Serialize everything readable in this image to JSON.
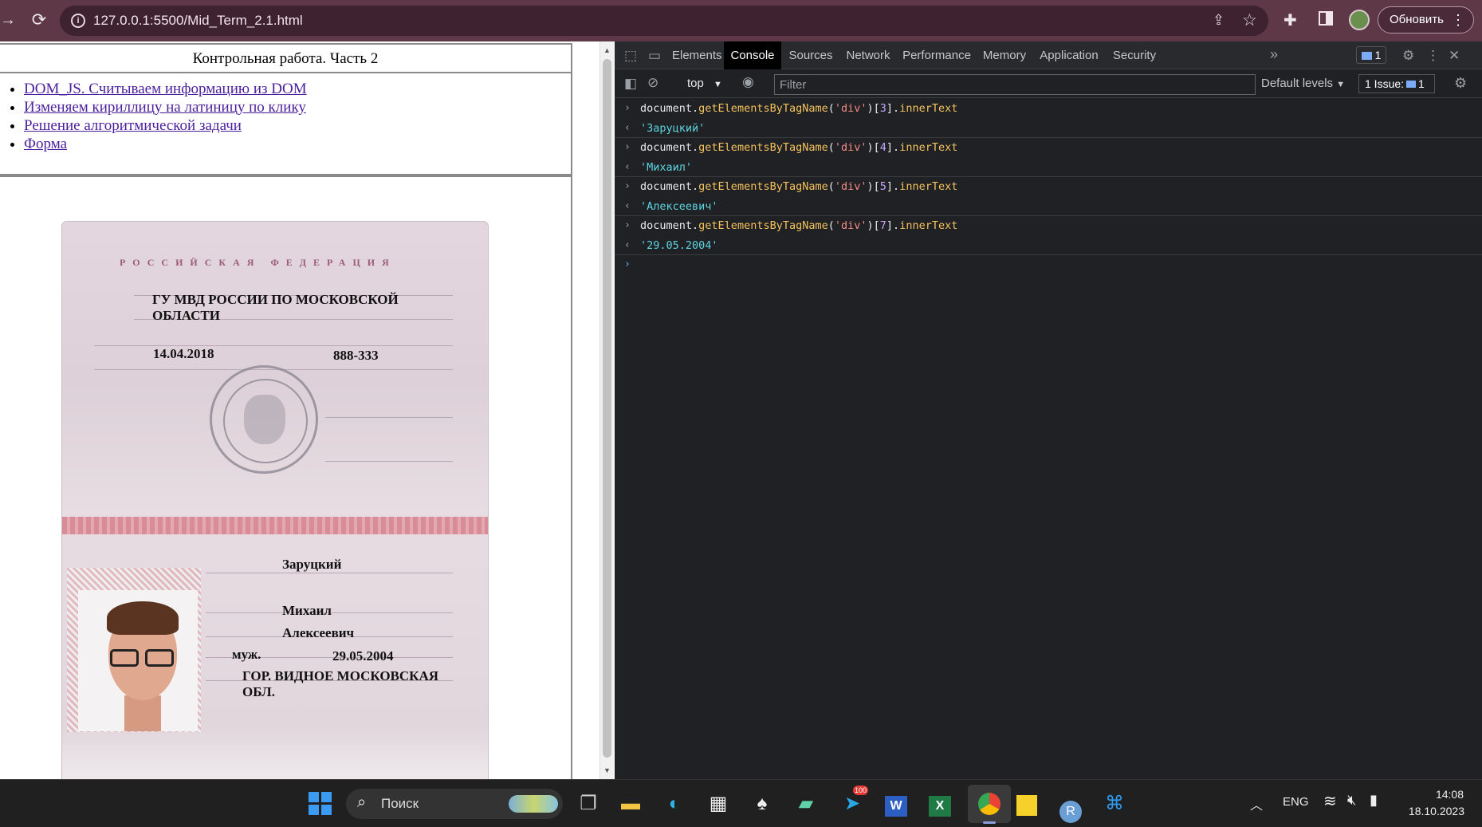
{
  "browser": {
    "url": "127.0.0.1:5500/Mid_Term_2.1.html",
    "update_label": "Обновить"
  },
  "page": {
    "title": "Контрольная работа. Часть 2",
    "nav_links": [
      "DOM_JS. Считываем информацию из DOM",
      "Изменяем кириллицу на латиницу по клику",
      "Решение алгоритмической задачи",
      "Форма"
    ],
    "passport": {
      "country": "РОССИЙСКАЯ ФЕДЕРАЦИЯ",
      "issued_by": "ГУ МВД РОССИИ ПО МОСКОВСКОЙ ОБЛАСТИ",
      "issue_date": "14.04.2018",
      "division_code": "888-333",
      "surname": "Заруцкий",
      "name": "Михаил",
      "patronymic": "Алексеевич",
      "sex": "муж.",
      "birth_date": "29.05.2004",
      "birth_place": "ГОР. ВИДНОЕ МОСКОВСКАЯ ОБЛ."
    }
  },
  "devtools": {
    "tabs": [
      "Elements",
      "Console",
      "Sources",
      "Network",
      "Performance",
      "Memory",
      "Application",
      "Security"
    ],
    "active_tab": "Console",
    "messages_badge": "1",
    "context": "top",
    "filter_placeholder": "Filter",
    "levels_label": "Default levels",
    "issues_prefix": "1 Issue:",
    "issues_count": "1",
    "console": [
      {
        "obj": "document",
        "fn": "getElementsByTagName",
        "arg": "'div'",
        "idx": "3",
        "prop": "innerText",
        "result": "'Заруцкий'"
      },
      {
        "obj": "document",
        "fn": "getElementsByTagName",
        "arg": "'div'",
        "idx": "4",
        "prop": "innerText",
        "result": "'Михаил'"
      },
      {
        "obj": "document",
        "fn": "getElementsByTagName",
        "arg": "'div'",
        "idx": "5",
        "prop": "innerText",
        "result": "'Алексеевич'"
      },
      {
        "obj": "document",
        "fn": "getElementsByTagName",
        "arg": "'div'",
        "idx": "7",
        "prop": "innerText",
        "result": "'29.05.2004'"
      }
    ]
  },
  "taskbar": {
    "search_label": "Поиск",
    "language": "ENG",
    "time": "14:08",
    "date": "18.10.2023",
    "telegram_badge": "100",
    "apps": [
      "task-view",
      "file-explorer",
      "edge",
      "microsoft-store",
      "solitaire",
      "app-sticker",
      "telegram",
      "word",
      "excel",
      "chrome",
      "sticky-notes",
      "r-app",
      "vscode"
    ]
  }
}
